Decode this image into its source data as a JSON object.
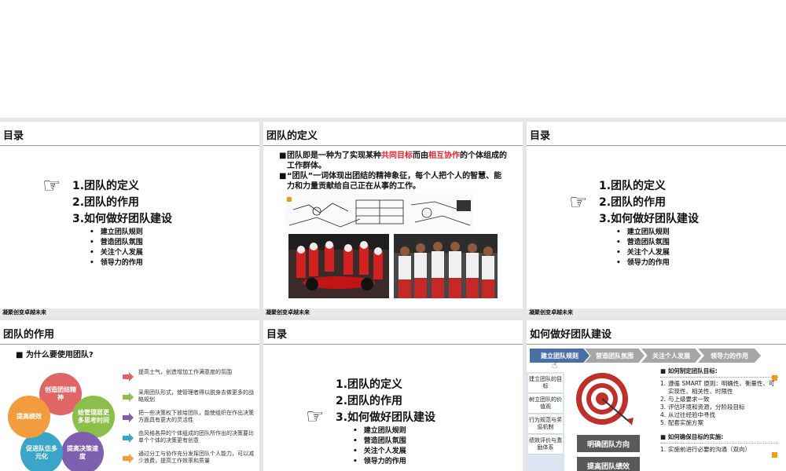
{
  "footer_text": "凝聚创变卓越未来",
  "toc": {
    "items": [
      "1.团队的定义",
      "2.团队的作用",
      "3.如何做好团队建设"
    ],
    "subitems": [
      "建立团队规则",
      "营造团队氛围",
      "关注个人发展",
      "领导力的作用"
    ]
  },
  "slides": {
    "s1": {
      "title": "目录"
    },
    "s2": {
      "title": "团队的定义",
      "para1_pre": "团队即是一种为了实现某种",
      "para1_red1": "共同目标",
      "para1_mid": "而由",
      "para1_red2": "相互协作",
      "para1_post": "的个体组成的工作群体。",
      "para2": "“团队”一词体现出团结的精神象征，每个人把个人的智慧、能力和力量贡献给自己正在从事的工作。"
    },
    "s3": {
      "title": "目录"
    },
    "s4": {
      "title": "团队的作用",
      "question": "为什么要使用团队?",
      "circles": [
        "创造团结精神",
        "给管理层更多思考时间",
        "提高决策速度",
        "促进队伍多元化",
        "提高绩效"
      ],
      "reasons": [
        "提高士气，创造增加工作满意度的氛围",
        "采用团队形式，使管理者得以脱身去做更多的战略规划",
        "把一些决策权下放给团队，能使组织在作出决策方面具有更大的灵活性",
        "由风格各异的个体组成的团队所作出的决策要比单个个体的决策更有创意",
        "通过分工与协作充分发挥团队个人能力，可以减少浪费，提高工作效率和质量"
      ]
    },
    "s5": {
      "title": "目录"
    },
    "s6": {
      "title": "如何做好团队建设",
      "steps": [
        "建立团队规则",
        "营造团队氛围",
        "关注个人发展",
        "领导力的作用"
      ],
      "side_items": [
        "建立团队的目标",
        "树立团队的价值观",
        "行为规范与奖惩机制",
        "绩效评价与激励体系"
      ],
      "btn1": "明确团队方向",
      "btn2": "提高团队绩效",
      "head1": "如何制定团队目标:",
      "list1": [
        "遵循 SMART 原则：明确性、衡量性、可实现性、相关性、时限性",
        "与上级要求一致",
        "评估环境和资源，分阶段目标",
        "从过往经验中寻找",
        "配套实施方案"
      ],
      "head2": "如何确保目标的实施:",
      "list2": [
        "实施前进行必要的沟通（双向）"
      ]
    }
  },
  "colors": {
    "accent_red": "#e0242b",
    "chevron_blue": "#4a6fa5",
    "chevron_grey": "#a6a6a6",
    "orange": "#f39c12"
  }
}
